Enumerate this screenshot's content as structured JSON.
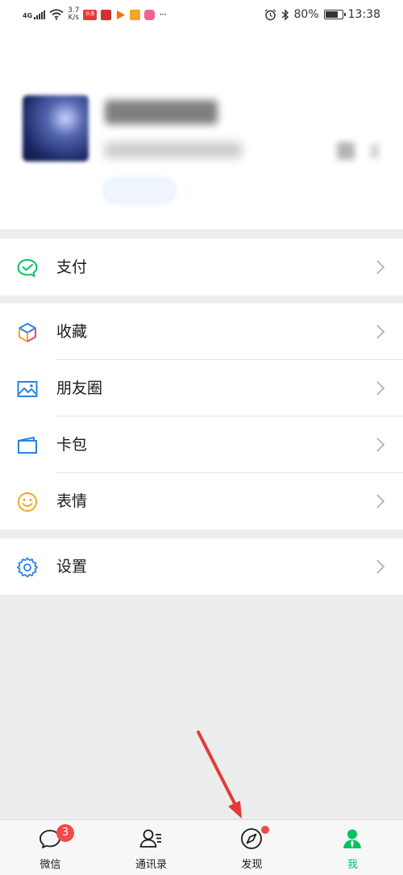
{
  "status_bar": {
    "network": "4G",
    "speed": "3.7\nK/s",
    "app_icons": [
      {
        "name": "toutiao-icon",
        "color": "#e53935",
        "text": "头条"
      },
      {
        "name": "red-app-icon",
        "color": "#d32f2f",
        "text": ""
      },
      {
        "name": "video-play-icon",
        "color": "#ff6d00",
        "text": ""
      },
      {
        "name": "game-app-icon",
        "color": "#f5a623",
        "text": ""
      },
      {
        "name": "pink-app-icon",
        "color": "#f06292",
        "text": ""
      }
    ],
    "more": "···",
    "battery": "80%",
    "battery_level": 0.8,
    "time": "13:38"
  },
  "menu": {
    "pay": {
      "label": "支付",
      "icon": "wechat-pay-icon",
      "color": "#07c160"
    },
    "favorites": {
      "label": "收藏",
      "icon": "cube-icon"
    },
    "moments": {
      "label": "朋友圈",
      "icon": "picture-icon",
      "color": "#2a82e4"
    },
    "cards": {
      "label": "卡包",
      "icon": "card-wallet-icon",
      "color": "#2a82e4"
    },
    "stickers": {
      "label": "表情",
      "icon": "smile-icon",
      "color": "#f5a623"
    },
    "settings": {
      "label": "设置",
      "icon": "gear-icon",
      "color": "#2a82e4"
    }
  },
  "tabbar": {
    "chats": {
      "label": "微信",
      "badge": "3",
      "icon": "chat-bubble-icon"
    },
    "contacts": {
      "label": "通讯录",
      "icon": "contacts-icon"
    },
    "discover": {
      "label": "发现",
      "icon": "compass-icon",
      "has_dot": true
    },
    "me": {
      "label": "我",
      "icon": "person-icon",
      "active": true,
      "color": "#07c160"
    }
  },
  "colors": {
    "accent": "#07c160",
    "badge": "#f04b4b",
    "annotation_arrow": "#e53935"
  }
}
